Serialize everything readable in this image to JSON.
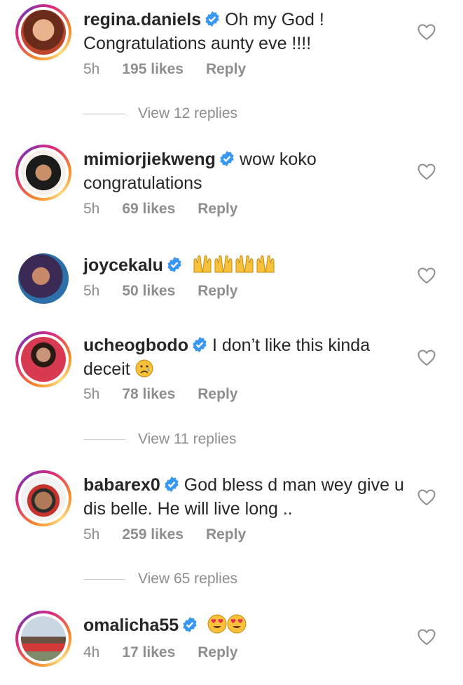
{
  "comments": [
    {
      "username": "regina.daniels",
      "text": "Oh my God ! Congratulations aunty eve !!!!",
      "time": "5h",
      "likes": "195 likes",
      "reply": "Reply",
      "view_replies": "View 12 replies"
    },
    {
      "username": "mimiorjiekweng",
      "text": "wow koko congratulations",
      "time": "5h",
      "likes": "69 likes",
      "reply": "Reply",
      "view_replies": ""
    },
    {
      "username": "joycekalu",
      "text": "",
      "time": "5h",
      "likes": "50 likes",
      "reply": "Reply",
      "view_replies": "",
      "emojis": [
        "raising-hands",
        "raising-hands",
        "raising-hands",
        "raising-hands"
      ]
    },
    {
      "username": "ucheogbodo",
      "text": "I don’t like this kinda deceit",
      "time": "5h",
      "likes": "78 likes",
      "reply": "Reply",
      "view_replies": "View 11 replies",
      "emojis": [
        "sad-tear"
      ]
    },
    {
      "username": "babarex0",
      "text": "God bless d man wey give u dis belle.  He will live long ..",
      "time": "5h",
      "likes": "259 likes",
      "reply": "Reply",
      "view_replies": "View 65 replies"
    },
    {
      "username": "omalicha55",
      "text": "",
      "time": "4h",
      "likes": "17 likes",
      "reply": "Reply",
      "view_replies": "",
      "emojis": [
        "heart-eyes",
        "heart-eyes"
      ]
    }
  ],
  "colors": {
    "verified": "#3897f0",
    "meta": "#8e8e8e",
    "text": "#262626"
  }
}
